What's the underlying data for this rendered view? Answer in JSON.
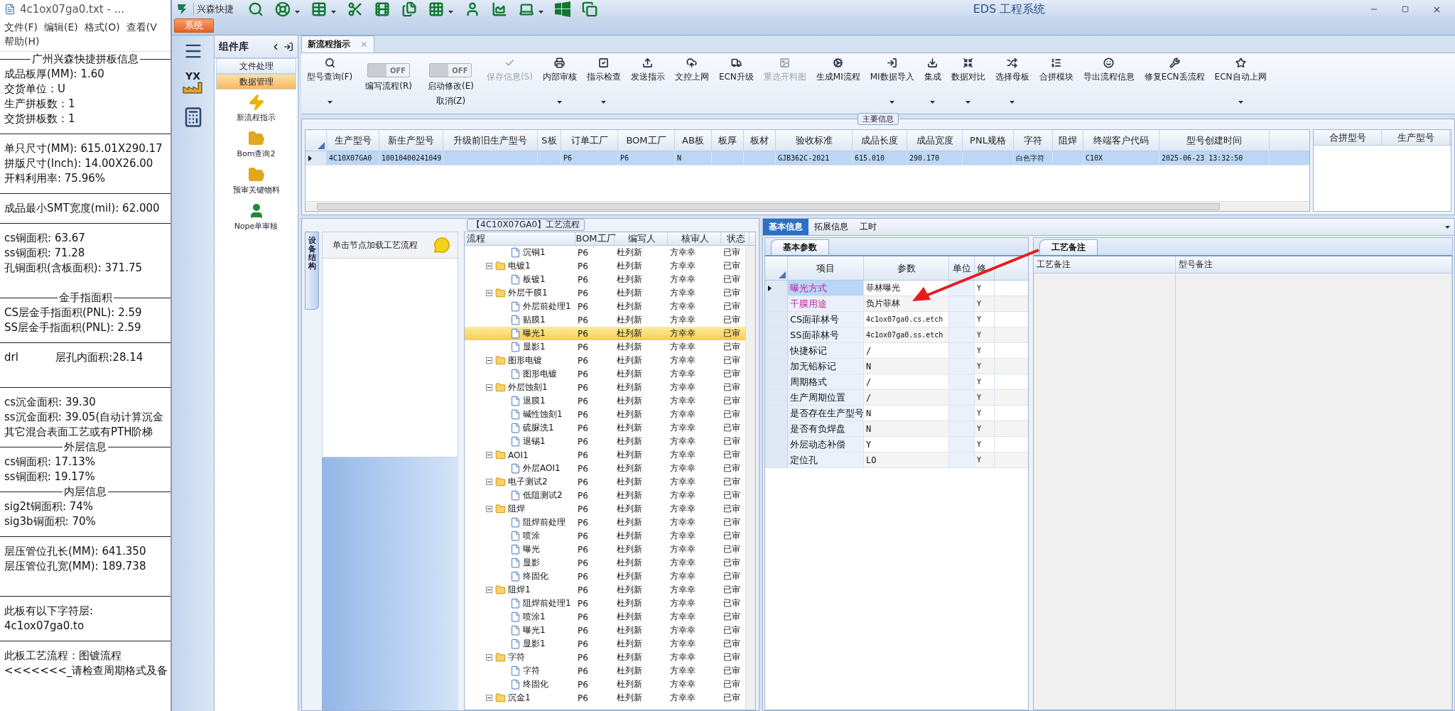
{
  "notepad": {
    "title": "4c1ox07ga0.txt - ...",
    "menu": [
      "文件(F)",
      "编辑(E)",
      "格式(O)",
      "查看(V",
      "帮助(H)"
    ],
    "lines": [
      {
        "kind": "heading",
        "text": "广州兴森快捷拼板信息"
      },
      {
        "kind": "text",
        "text": "成品板厚(MM): 1.60"
      },
      {
        "kind": "text",
        "text": "交货单位：U"
      },
      {
        "kind": "text",
        "text": "生产拼板数：1"
      },
      {
        "kind": "text",
        "text": "交货拼板数：1"
      },
      {
        "kind": "rule"
      },
      {
        "kind": "text",
        "text": "单只尺寸(MM): 615.01X290.17"
      },
      {
        "kind": "text",
        "text": "拼版尺寸(Inch): 14.00X26.00"
      },
      {
        "kind": "text",
        "text": "开料利用率: 75.96%"
      },
      {
        "kind": "rule"
      },
      {
        "kind": "text",
        "text": "成品最小SMT宽度(mil): 62.000"
      },
      {
        "kind": "rule"
      },
      {
        "kind": "text",
        "text": "cs铜面积: 63.67"
      },
      {
        "kind": "text",
        "text": "ss铜面积: 71.28"
      },
      {
        "kind": "text",
        "text": "孔铜面积(含板面积): 371.75"
      },
      {
        "kind": "blank"
      },
      {
        "kind": "heading",
        "text": "金手指面积"
      },
      {
        "kind": "text",
        "text": "CS层金手指面积(PNL): 2.59"
      },
      {
        "kind": "text",
        "text": "SS层金手指面积(PNL): 2.59"
      },
      {
        "kind": "rule"
      },
      {
        "kind": "text",
        "text": "drl           层孔内面积:28.14"
      },
      {
        "kind": "blank"
      },
      {
        "kind": "rule"
      },
      {
        "kind": "text",
        "text": "cs沉金面积: 39.30"
      },
      {
        "kind": "text",
        "text": "ss沉金面积: 39.05(自动计算沉金"
      },
      {
        "kind": "text",
        "text": "其它混合表面工艺或有PTH阶梯"
      },
      {
        "kind": "heading",
        "text": "外层信息"
      },
      {
        "kind": "text",
        "text": "cs铜面积: 17.13%"
      },
      {
        "kind": "text",
        "text": "ss铜面积: 19.17%"
      },
      {
        "kind": "heading",
        "text": "内层信息"
      },
      {
        "kind": "text",
        "text": "sig2t铜面积: 74%"
      },
      {
        "kind": "text",
        "text": "sig3b铜面积: 70%"
      },
      {
        "kind": "rule"
      },
      {
        "kind": "text",
        "text": "层压管位孔长(MM): 641.350"
      },
      {
        "kind": "text",
        "text": "层压管位孔宽(MM): 189.738"
      },
      {
        "kind": "blank"
      },
      {
        "kind": "rule"
      },
      {
        "kind": "text",
        "text": "此板有以下字符层:"
      },
      {
        "kind": "text",
        "text": "4c1ox07ga0.to"
      },
      {
        "kind": "rule"
      },
      {
        "kind": "text",
        "text": "此板工艺流程：图镀流程"
      },
      {
        "kind": "text",
        "text": "<<<<<<<_请检查周期格式及备"
      }
    ]
  },
  "app": {
    "brand": "兴森快捷",
    "title": "EDS 工程系统",
    "system_tab": "系统",
    "sidebar_logo": "YX"
  },
  "component_library": {
    "title": "组件库",
    "categories": [
      {
        "label": "文件处理",
        "selected": false
      },
      {
        "label": "数据管理",
        "selected": true
      }
    ],
    "items": [
      {
        "label": "新流程指示"
      },
      {
        "label": "Bom查询2"
      },
      {
        "label": "预审关键物料"
      },
      {
        "label": "Nope单审核"
      }
    ]
  },
  "document_tabs": [
    {
      "label": "新流程指示",
      "selected": true
    }
  ],
  "toolbar": [
    {
      "kind": "button",
      "label": "型号查询(F)",
      "dropdown": true,
      "disabled": false
    },
    {
      "kind": "toggle",
      "label": "编写流程(R)",
      "switch_text": "OFF",
      "on": false
    },
    {
      "kind": "toggle",
      "label": "启动修改(E)",
      "second_line": "取消(Z)",
      "switch_text": "OFF",
      "on": false
    },
    {
      "kind": "button",
      "label": "保存信息(S)",
      "dropdown": false,
      "disabled": true
    },
    {
      "kind": "button",
      "label": "内部审核",
      "dropdown": true,
      "disabled": false
    },
    {
      "kind": "button",
      "label": "指示检查",
      "dropdown": true,
      "disabled": false
    },
    {
      "kind": "button",
      "label": "发送指示",
      "dropdown": false,
      "disabled": false
    },
    {
      "kind": "button",
      "label": "文控上网",
      "dropdown": false,
      "disabled": false
    },
    {
      "kind": "button",
      "label": "ECN升级",
      "dropdown": false,
      "disabled": false
    },
    {
      "kind": "button",
      "label": "重选开料图",
      "dropdown": false,
      "disabled": true
    },
    {
      "kind": "button",
      "label": "生成MI流程",
      "dropdown": false,
      "disabled": false
    },
    {
      "kind": "button",
      "label": "MI数据导入",
      "dropdown": true,
      "disabled": false
    },
    {
      "kind": "button",
      "label": "集成",
      "dropdown": true,
      "disabled": false
    },
    {
      "kind": "button",
      "label": "数据对比",
      "dropdown": true,
      "disabled": false
    },
    {
      "kind": "button",
      "label": "选择母板",
      "dropdown": true,
      "disabled": false
    },
    {
      "kind": "button",
      "label": "合拼模块",
      "dropdown": false,
      "disabled": false
    },
    {
      "kind": "button",
      "label": "导出流程信息",
      "dropdown": false,
      "disabled": false
    },
    {
      "kind": "button",
      "label": "修复ECN丢流程",
      "dropdown": false,
      "disabled": false
    },
    {
      "kind": "button",
      "label": "ECN自动上网",
      "dropdown": true,
      "disabled": false
    }
  ],
  "main_info": {
    "legend": "主要信息",
    "row_selected": true,
    "columns": [
      {
        "label": "生产型号",
        "value": "4C10X07GA0"
      },
      {
        "label": "新生产型号",
        "value": "10010400241049"
      },
      {
        "label": "升级前旧生产型号"
      },
      {
        "label": "S板"
      },
      {
        "label": "订单工厂",
        "value": "P6"
      },
      {
        "label": "BOM工厂",
        "value": "P6"
      },
      {
        "label": "AB板",
        "value": "N"
      },
      {
        "label": "板厚"
      },
      {
        "label": "板材"
      },
      {
        "label": "验收标准",
        "value": "GJB362C-2021"
      },
      {
        "label": "成品长度",
        "value": "615.010"
      },
      {
        "label": "成品宽度",
        "value": "290.170"
      },
      {
        "label": "PNL规格"
      },
      {
        "label": "字符",
        "value": "白色字符"
      },
      {
        "label": "阻焊"
      },
      {
        "label": "终端客户代码",
        "value": "C10X"
      },
      {
        "label": "型号创建时间",
        "value": "2025-06-23 13:32:50"
      }
    ],
    "merge_columns": [
      "合拼型号",
      "生产型号"
    ]
  },
  "process_flow": {
    "legend": "【4C10X07GA0】工艺流程",
    "side_tab": "设备结构",
    "hint": "单击节点加载工艺流程",
    "columns": [
      "流程",
      "BOM工厂",
      "编写人",
      "核审人",
      "状态"
    ],
    "tree": [
      {
        "children": [
          {
            "label": "沉铜1",
            "bom": "P6",
            "writer": "杜列新",
            "reviewer": "方幸幸",
            "status": "已审",
            "selected": false
          }
        ]
      },
      {
        "label": "电镀1",
        "bom": "P6",
        "writer": "杜列新",
        "reviewer": "方幸幸",
        "status": "已审",
        "selected": false,
        "expanded": true,
        "children": [
          {
            "label": "板镀1",
            "bom": "P6",
            "writer": "杜列新",
            "reviewer": "方幸幸",
            "status": "已审",
            "selected": false
          }
        ]
      },
      {
        "label": "外层干膜1",
        "bom": "P6",
        "writer": "杜列新",
        "reviewer": "方幸幸",
        "status": "已审",
        "selected": false,
        "expanded": true,
        "children": [
          {
            "label": "外层前处理1",
            "bom": "P6",
            "writer": "杜列新",
            "reviewer": "方幸幸",
            "status": "已审",
            "selected": false
          },
          {
            "label": "贴膜1",
            "bom": "P6",
            "writer": "杜列新",
            "reviewer": "方幸幸",
            "status": "已审",
            "selected": false
          },
          {
            "label": "曝光1",
            "bom": "P6",
            "writer": "杜列新",
            "reviewer": "方幸幸",
            "status": "已审",
            "selected": true
          },
          {
            "label": "显影1",
            "bom": "P6",
            "writer": "杜列新",
            "reviewer": "方幸幸",
            "status": "已审",
            "selected": false
          }
        ]
      },
      {
        "label": "图形电镀",
        "bom": "P6",
        "writer": "杜列新",
        "reviewer": "方幸幸",
        "status": "已审",
        "selected": false,
        "expanded": true,
        "children": [
          {
            "label": "图形电镀",
            "bom": "P6",
            "writer": "杜列新",
            "reviewer": "方幸幸",
            "status": "已审",
            "selected": false
          }
        ]
      },
      {
        "label": "外层蚀刻1",
        "bom": "P6",
        "writer": "杜列新",
        "reviewer": "方幸幸",
        "status": "已审",
        "selected": false,
        "expanded": true,
        "children": [
          {
            "label": "退膜1",
            "bom": "P6",
            "writer": "杜列新",
            "reviewer": "方幸幸",
            "status": "已审",
            "selected": false
          },
          {
            "label": "碱性蚀刻1",
            "bom": "P6",
            "writer": "杜列新",
            "reviewer": "方幸幸",
            "status": "已审",
            "selected": false
          },
          {
            "label": "硫脲洗1",
            "bom": "P6",
            "writer": "杜列新",
            "reviewer": "方幸幸",
            "status": "已审",
            "selected": false
          },
          {
            "label": "退锡1",
            "bom": "P6",
            "writer": "杜列新",
            "reviewer": "方幸幸",
            "status": "已审",
            "selected": false
          }
        ]
      },
      {
        "label": "AOI1",
        "bom": "P6",
        "writer": "杜列新",
        "reviewer": "方幸幸",
        "status": "已审",
        "selected": false,
        "expanded": true,
        "children": [
          {
            "label": "外层AOI1",
            "bom": "P6",
            "writer": "杜列新",
            "reviewer": "方幸幸",
            "status": "已审",
            "selected": false
          }
        ]
      },
      {
        "label": "电子测试2",
        "bom": "P6",
        "writer": "杜列新",
        "reviewer": "方幸幸",
        "status": "已审",
        "selected": false,
        "expanded": true,
        "children": [
          {
            "label": "低阻测试2",
            "bom": "P6",
            "writer": "杜列新",
            "reviewer": "方幸幸",
            "status": "已审",
            "selected": false
          }
        ]
      },
      {
        "label": "阻焊",
        "bom": "P6",
        "writer": "杜列新",
        "reviewer": "方幸幸",
        "status": "已审",
        "selected": false,
        "expanded": true,
        "children": [
          {
            "label": "阻焊前处理",
            "bom": "P6",
            "writer": "杜列新",
            "reviewer": "方幸幸",
            "status": "已审",
            "selected": false
          },
          {
            "label": "喷涂",
            "bom": "P6",
            "writer": "杜列新",
            "reviewer": "方幸幸",
            "status": "已审",
            "selected": false
          },
          {
            "label": "曝光",
            "bom": "P6",
            "writer": "杜列新",
            "reviewer": "方幸幸",
            "status": "已审",
            "selected": false
          },
          {
            "label": "显影",
            "bom": "P6",
            "writer": "杜列新",
            "reviewer": "方幸幸",
            "status": "已审",
            "selected": false
          },
          {
            "label": "终固化",
            "bom": "P6",
            "writer": "杜列新",
            "reviewer": "方幸幸",
            "status": "已审",
            "selected": false
          }
        ]
      },
      {
        "label": "阻焊1",
        "bom": "P6",
        "writer": "杜列新",
        "reviewer": "方幸幸",
        "status": "已审",
        "selected": false,
        "expanded": true,
        "children": [
          {
            "label": "阻焊前处理1",
            "bom": "P6",
            "writer": "杜列新",
            "reviewer": "方幸幸",
            "status": "已审",
            "selected": false
          },
          {
            "label": "喷涂1",
            "bom": "P6",
            "writer": "杜列新",
            "reviewer": "方幸幸",
            "status": "已审",
            "selected": false
          },
          {
            "label": "曝光1",
            "bom": "P6",
            "writer": "杜列新",
            "reviewer": "方幸幸",
            "status": "已审",
            "selected": false
          },
          {
            "label": "显影1",
            "bom": "P6",
            "writer": "杜列新",
            "reviewer": "方幸幸",
            "status": "已审",
            "selected": false
          }
        ]
      },
      {
        "label": "字符",
        "bom": "P6",
        "writer": "杜列新",
        "reviewer": "方幸幸",
        "status": "已审",
        "selected": false,
        "expanded": true,
        "children": [
          {
            "label": "字符",
            "bom": "P6",
            "writer": "杜列新",
            "reviewer": "方幸幸",
            "status": "已审",
            "selected": false
          },
          {
            "label": "终固化",
            "bom": "P6",
            "writer": "杜列新",
            "reviewer": "方幸幸",
            "status": "已审",
            "selected": false
          }
        ]
      },
      {
        "label": "沉金1",
        "bom": "P6",
        "writer": "杜列新",
        "reviewer": "方幸幸",
        "status": "已审",
        "selected": false,
        "expanded": true
      }
    ]
  },
  "detail_tabs": [
    {
      "label": "基本信息",
      "selected": true
    },
    {
      "label": "拓展信息",
      "selected": false
    },
    {
      "label": "工时",
      "selected": false
    }
  ],
  "basic_params": {
    "tab": "基本参数",
    "columns": [
      "项目",
      "参数",
      "单位",
      "修.."
    ],
    "rows": [
      {
        "item": "曝光方式",
        "value": "菲林曝光",
        "modified": "Y",
        "highlighted": true,
        "selected": true
      },
      {
        "item": "干膜用途",
        "value": "负片菲林",
        "modified": "Y",
        "highlighted": true,
        "selected": false
      },
      {
        "item": "CS面菲林号",
        "value": "4c1ox07ga0.cs.etch",
        "modified": "Y",
        "highlighted": false,
        "selected": false
      },
      {
        "item": "SS面菲林号",
        "value": "4c1ox07ga0.ss.etch",
        "modified": "Y",
        "highlighted": false,
        "selected": false
      },
      {
        "item": "快捷标记",
        "value": "/",
        "modified": "Y",
        "highlighted": false,
        "selected": false
      },
      {
        "item": "加无铅标记",
        "value": "N",
        "modified": "Y",
        "highlighted": false,
        "selected": false
      },
      {
        "item": "周期格式",
        "value": "/",
        "modified": "Y",
        "highlighted": false,
        "selected": false
      },
      {
        "item": "生产周期位置",
        "value": "/",
        "modified": "Y",
        "highlighted": false,
        "selected": false
      },
      {
        "item": "是否存在生产型号",
        "value": "N",
        "modified": "Y",
        "highlighted": false,
        "selected": false
      },
      {
        "item": "是否有负焊盘",
        "value": "N",
        "modified": "Y",
        "highlighted": false,
        "selected": false
      },
      {
        "item": "外层动态补偿",
        "value": "Y",
        "modified": "Y",
        "highlighted": false,
        "selected": false
      },
      {
        "item": "定位孔",
        "value": "LO",
        "modified": "Y",
        "highlighted": false,
        "selected": false
      }
    ]
  },
  "remarks": {
    "tab": "工艺备注",
    "columns": [
      "工艺备注",
      "型号备注"
    ]
  }
}
